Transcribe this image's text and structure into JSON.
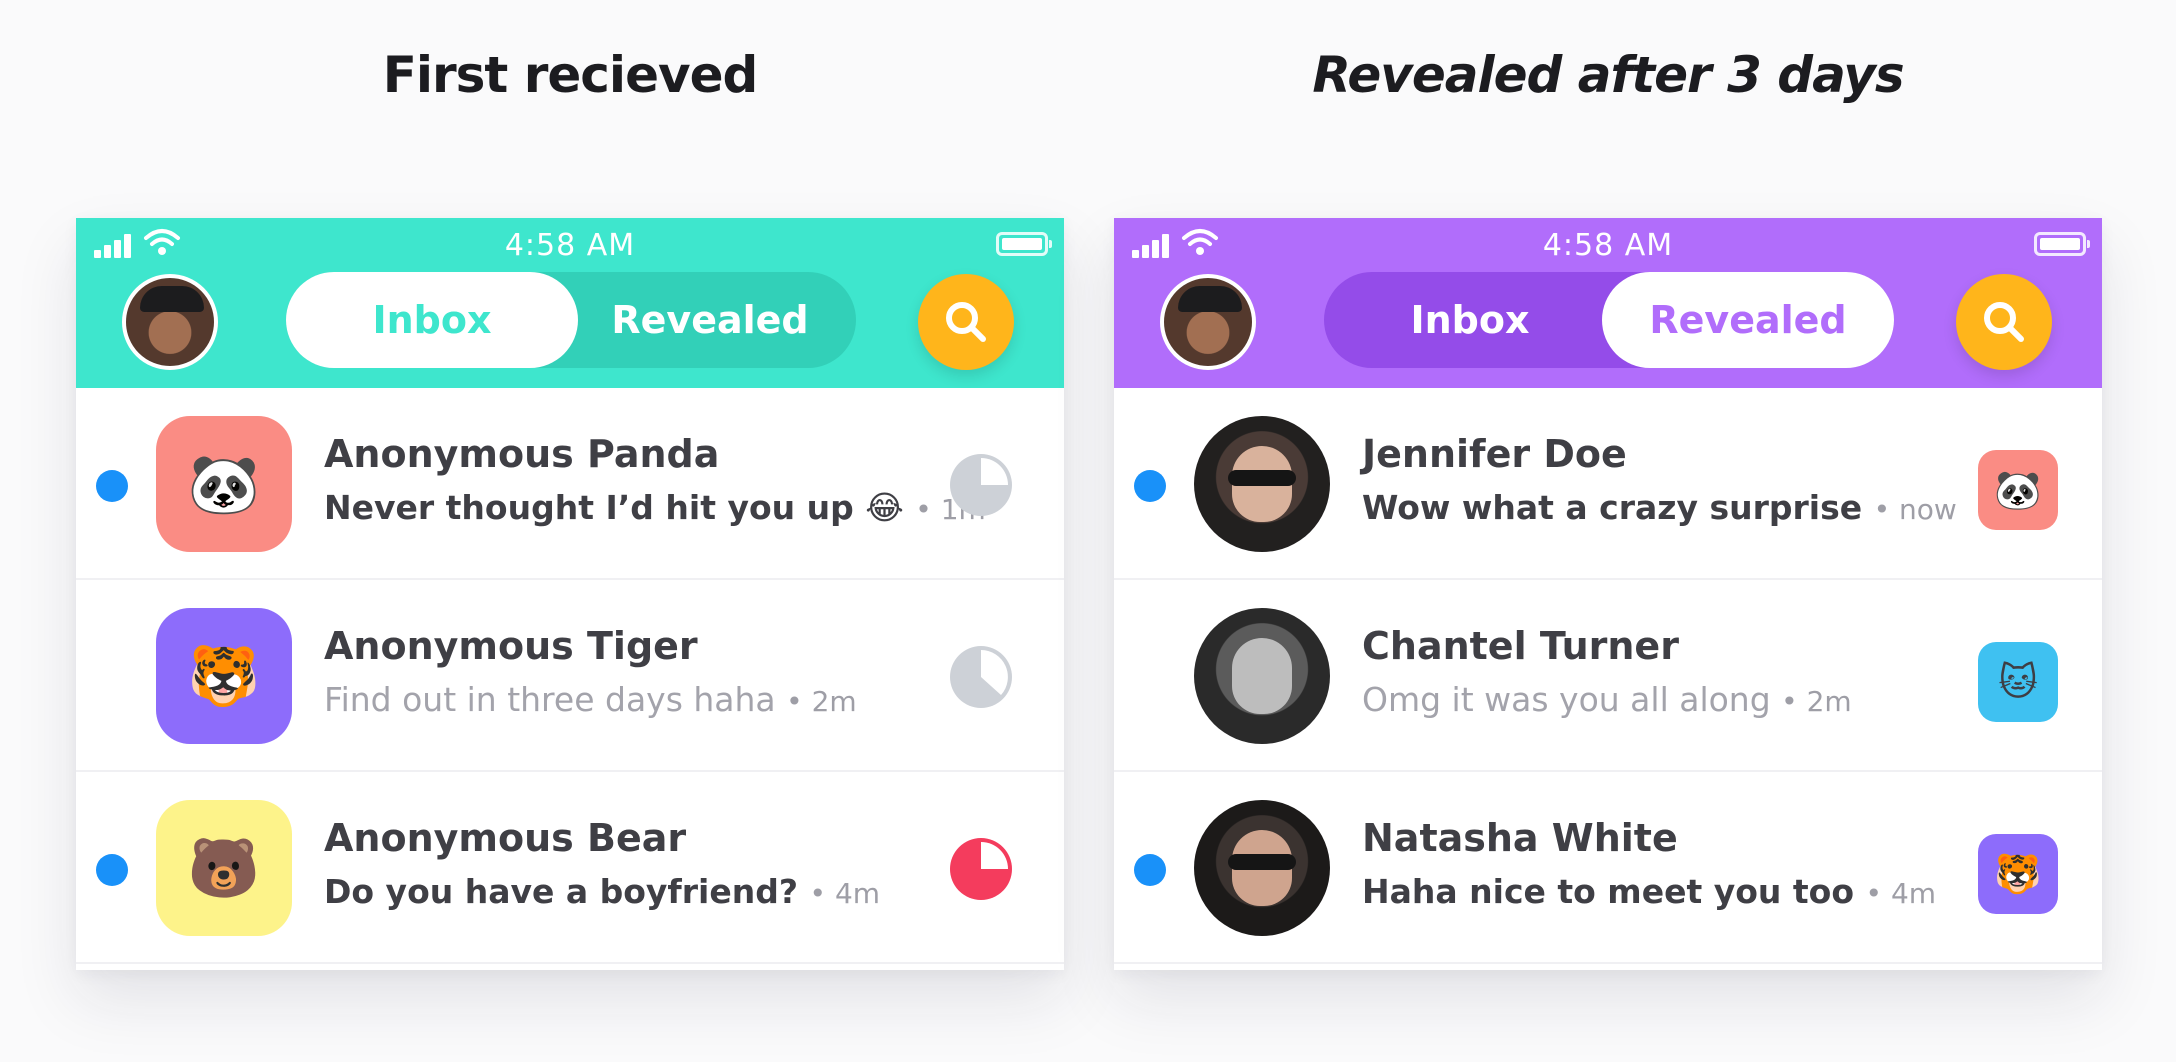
{
  "headings": {
    "left": "First recieved",
    "right": "Revealed after 3 days"
  },
  "phones": {
    "left": {
      "accent": "#3ee6cd",
      "status": {
        "time": "4:58 AM"
      },
      "tabs": {
        "inbox": "Inbox",
        "revealed": "Revealed",
        "active": "Inbox"
      },
      "rows": [
        {
          "name": "Anonymous Panda",
          "message": "Never thought I’d hit you up 😂",
          "sep": "•",
          "time": "1m",
          "unread": true,
          "emoji": "🐼",
          "tile_color": "#fa8c84",
          "timer_progress": 0.25,
          "timer_color": "#cdd1d7"
        },
        {
          "name": "Anonymous Tiger",
          "message": "Find out in three days haha",
          "sep": "•",
          "time": "2m",
          "unread": false,
          "emoji": "🐯",
          "tile_color": "#8d6cfb",
          "timer_progress": 0.38,
          "timer_color": "#cdd1d7"
        },
        {
          "name": "Anonymous Bear",
          "message": "Do you have a boyfriend?",
          "sep": "•",
          "time": "4m",
          "unread": true,
          "emoji": "🐻",
          "tile_color": "#fdf38a",
          "timer_progress": 0.75,
          "timer_color": "#f43c5d"
        }
      ]
    },
    "right": {
      "accent": "#b16dfb",
      "status": {
        "time": "4:58 AM"
      },
      "tabs": {
        "inbox": "Inbox",
        "revealed": "Revealed",
        "active": "Revealed"
      },
      "rows": [
        {
          "name": "Jennifer Doe",
          "message": "Wow what a crazy surprise",
          "sep": "•",
          "time": "now",
          "unread": true,
          "emoji": "🐼",
          "tile_color": "#fa8c84"
        },
        {
          "name": "Chantel Turner",
          "message": "Omg it was you all along",
          "sep": "•",
          "time": "2m",
          "unread": false,
          "emoji": "🐱",
          "tile_color": "#3fc1f1"
        },
        {
          "name": "Natasha White",
          "message": "Haha nice to meet you too",
          "sep": "•",
          "time": "4m",
          "unread": true,
          "emoji": "🐯",
          "tile_color": "#8d6cfb"
        }
      ]
    }
  }
}
